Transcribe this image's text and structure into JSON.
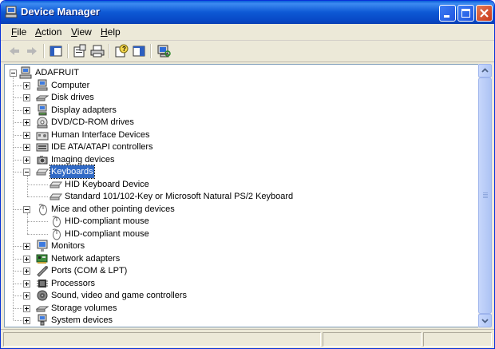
{
  "window": {
    "title": "Device Manager"
  },
  "menu": {
    "items": [
      {
        "mnemonic": "F",
        "rest": "ile"
      },
      {
        "mnemonic": "A",
        "rest": "ction"
      },
      {
        "mnemonic": "V",
        "rest": "iew"
      },
      {
        "mnemonic": "H",
        "rest": "elp"
      }
    ]
  },
  "toolbar": {
    "buttons": [
      "back-arrow-icon",
      "forward-arrow-icon",
      "show-hide-console-tree-icon",
      "properties-icon",
      "print-icon",
      "help-icon",
      "show-hide-action-pane-icon",
      "scan-hardware-icon"
    ]
  },
  "tree": {
    "root": {
      "label": "ADAFRUIT",
      "expanded": true
    },
    "categories": [
      {
        "label": "Computer",
        "expanded": false,
        "icon": "computer-icon"
      },
      {
        "label": "Disk drives",
        "expanded": false,
        "icon": "disk-drive-icon"
      },
      {
        "label": "Display adapters",
        "expanded": false,
        "icon": "display-adapter-icon"
      },
      {
        "label": "DVD/CD-ROM drives",
        "expanded": false,
        "icon": "cdrom-icon"
      },
      {
        "label": "Human Interface Devices",
        "expanded": false,
        "icon": "hid-icon"
      },
      {
        "label": "IDE ATA/ATAPI controllers",
        "expanded": false,
        "icon": "ide-controller-icon"
      },
      {
        "label": "Imaging devices",
        "expanded": false,
        "icon": "camera-icon"
      },
      {
        "label": "Keyboards",
        "expanded": true,
        "selected": true,
        "icon": "keyboard-icon",
        "children": [
          "HID Keyboard Device",
          "Standard 101/102-Key or Microsoft Natural PS/2 Keyboard"
        ]
      },
      {
        "label": "Mice and other pointing devices",
        "expanded": true,
        "icon": "mouse-icon",
        "children": [
          "HID-compliant mouse",
          "HID-compliant mouse"
        ]
      },
      {
        "label": "Monitors",
        "expanded": false,
        "icon": "monitor-icon"
      },
      {
        "label": "Network adapters",
        "expanded": false,
        "icon": "network-adapter-icon"
      },
      {
        "label": "Ports (COM & LPT)",
        "expanded": false,
        "icon": "port-icon"
      },
      {
        "label": "Processors",
        "expanded": false,
        "icon": "processor-icon"
      },
      {
        "label": "Sound, video and game controllers",
        "expanded": false,
        "icon": "sound-icon"
      },
      {
        "label": "Storage volumes",
        "expanded": false,
        "icon": "storage-volume-icon"
      },
      {
        "label": "System devices",
        "expanded": false,
        "icon": "system-device-icon"
      }
    ]
  },
  "colors": {
    "titlebar": "#0a5fd8",
    "selection": "#316ac5",
    "window_bg": "#ece9d8",
    "close_button": "#c8381a"
  }
}
